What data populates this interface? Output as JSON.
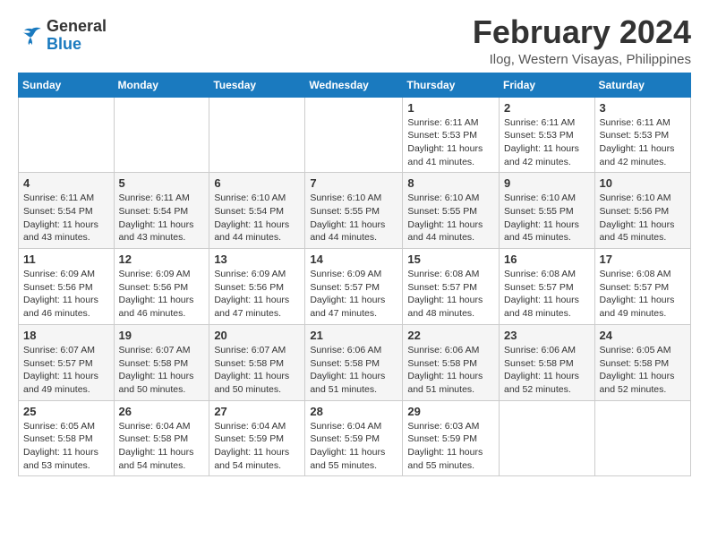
{
  "logo": {
    "text_general": "General",
    "text_blue": "Blue"
  },
  "header": {
    "month": "February 2024",
    "location": "Ilog, Western Visayas, Philippines"
  },
  "days_of_week": [
    "Sunday",
    "Monday",
    "Tuesday",
    "Wednesday",
    "Thursday",
    "Friday",
    "Saturday"
  ],
  "weeks": [
    [
      {
        "day": "",
        "sunrise": "",
        "sunset": "",
        "daylight": ""
      },
      {
        "day": "",
        "sunrise": "",
        "sunset": "",
        "daylight": ""
      },
      {
        "day": "",
        "sunrise": "",
        "sunset": "",
        "daylight": ""
      },
      {
        "day": "",
        "sunrise": "",
        "sunset": "",
        "daylight": ""
      },
      {
        "day": "1",
        "sunrise": "Sunrise: 6:11 AM",
        "sunset": "Sunset: 5:53 PM",
        "daylight": "Daylight: 11 hours and 41 minutes."
      },
      {
        "day": "2",
        "sunrise": "Sunrise: 6:11 AM",
        "sunset": "Sunset: 5:53 PM",
        "daylight": "Daylight: 11 hours and 42 minutes."
      },
      {
        "day": "3",
        "sunrise": "Sunrise: 6:11 AM",
        "sunset": "Sunset: 5:53 PM",
        "daylight": "Daylight: 11 hours and 42 minutes."
      }
    ],
    [
      {
        "day": "4",
        "sunrise": "Sunrise: 6:11 AM",
        "sunset": "Sunset: 5:54 PM",
        "daylight": "Daylight: 11 hours and 43 minutes."
      },
      {
        "day": "5",
        "sunrise": "Sunrise: 6:11 AM",
        "sunset": "Sunset: 5:54 PM",
        "daylight": "Daylight: 11 hours and 43 minutes."
      },
      {
        "day": "6",
        "sunrise": "Sunrise: 6:10 AM",
        "sunset": "Sunset: 5:54 PM",
        "daylight": "Daylight: 11 hours and 44 minutes."
      },
      {
        "day": "7",
        "sunrise": "Sunrise: 6:10 AM",
        "sunset": "Sunset: 5:55 PM",
        "daylight": "Daylight: 11 hours and 44 minutes."
      },
      {
        "day": "8",
        "sunrise": "Sunrise: 6:10 AM",
        "sunset": "Sunset: 5:55 PM",
        "daylight": "Daylight: 11 hours and 44 minutes."
      },
      {
        "day": "9",
        "sunrise": "Sunrise: 6:10 AM",
        "sunset": "Sunset: 5:55 PM",
        "daylight": "Daylight: 11 hours and 45 minutes."
      },
      {
        "day": "10",
        "sunrise": "Sunrise: 6:10 AM",
        "sunset": "Sunset: 5:56 PM",
        "daylight": "Daylight: 11 hours and 45 minutes."
      }
    ],
    [
      {
        "day": "11",
        "sunrise": "Sunrise: 6:09 AM",
        "sunset": "Sunset: 5:56 PM",
        "daylight": "Daylight: 11 hours and 46 minutes."
      },
      {
        "day": "12",
        "sunrise": "Sunrise: 6:09 AM",
        "sunset": "Sunset: 5:56 PM",
        "daylight": "Daylight: 11 hours and 46 minutes."
      },
      {
        "day": "13",
        "sunrise": "Sunrise: 6:09 AM",
        "sunset": "Sunset: 5:56 PM",
        "daylight": "Daylight: 11 hours and 47 minutes."
      },
      {
        "day": "14",
        "sunrise": "Sunrise: 6:09 AM",
        "sunset": "Sunset: 5:57 PM",
        "daylight": "Daylight: 11 hours and 47 minutes."
      },
      {
        "day": "15",
        "sunrise": "Sunrise: 6:08 AM",
        "sunset": "Sunset: 5:57 PM",
        "daylight": "Daylight: 11 hours and 48 minutes."
      },
      {
        "day": "16",
        "sunrise": "Sunrise: 6:08 AM",
        "sunset": "Sunset: 5:57 PM",
        "daylight": "Daylight: 11 hours and 48 minutes."
      },
      {
        "day": "17",
        "sunrise": "Sunrise: 6:08 AM",
        "sunset": "Sunset: 5:57 PM",
        "daylight": "Daylight: 11 hours and 49 minutes."
      }
    ],
    [
      {
        "day": "18",
        "sunrise": "Sunrise: 6:07 AM",
        "sunset": "Sunset: 5:57 PM",
        "daylight": "Daylight: 11 hours and 49 minutes."
      },
      {
        "day": "19",
        "sunrise": "Sunrise: 6:07 AM",
        "sunset": "Sunset: 5:58 PM",
        "daylight": "Daylight: 11 hours and 50 minutes."
      },
      {
        "day": "20",
        "sunrise": "Sunrise: 6:07 AM",
        "sunset": "Sunset: 5:58 PM",
        "daylight": "Daylight: 11 hours and 50 minutes."
      },
      {
        "day": "21",
        "sunrise": "Sunrise: 6:06 AM",
        "sunset": "Sunset: 5:58 PM",
        "daylight": "Daylight: 11 hours and 51 minutes."
      },
      {
        "day": "22",
        "sunrise": "Sunrise: 6:06 AM",
        "sunset": "Sunset: 5:58 PM",
        "daylight": "Daylight: 11 hours and 51 minutes."
      },
      {
        "day": "23",
        "sunrise": "Sunrise: 6:06 AM",
        "sunset": "Sunset: 5:58 PM",
        "daylight": "Daylight: 11 hours and 52 minutes."
      },
      {
        "day": "24",
        "sunrise": "Sunrise: 6:05 AM",
        "sunset": "Sunset: 5:58 PM",
        "daylight": "Daylight: 11 hours and 52 minutes."
      }
    ],
    [
      {
        "day": "25",
        "sunrise": "Sunrise: 6:05 AM",
        "sunset": "Sunset: 5:58 PM",
        "daylight": "Daylight: 11 hours and 53 minutes."
      },
      {
        "day": "26",
        "sunrise": "Sunrise: 6:04 AM",
        "sunset": "Sunset: 5:58 PM",
        "daylight": "Daylight: 11 hours and 54 minutes."
      },
      {
        "day": "27",
        "sunrise": "Sunrise: 6:04 AM",
        "sunset": "Sunset: 5:59 PM",
        "daylight": "Daylight: 11 hours and 54 minutes."
      },
      {
        "day": "28",
        "sunrise": "Sunrise: 6:04 AM",
        "sunset": "Sunset: 5:59 PM",
        "daylight": "Daylight: 11 hours and 55 minutes."
      },
      {
        "day": "29",
        "sunrise": "Sunrise: 6:03 AM",
        "sunset": "Sunset: 5:59 PM",
        "daylight": "Daylight: 11 hours and 55 minutes."
      },
      {
        "day": "",
        "sunrise": "",
        "sunset": "",
        "daylight": ""
      },
      {
        "day": "",
        "sunrise": "",
        "sunset": "",
        "daylight": ""
      }
    ]
  ]
}
